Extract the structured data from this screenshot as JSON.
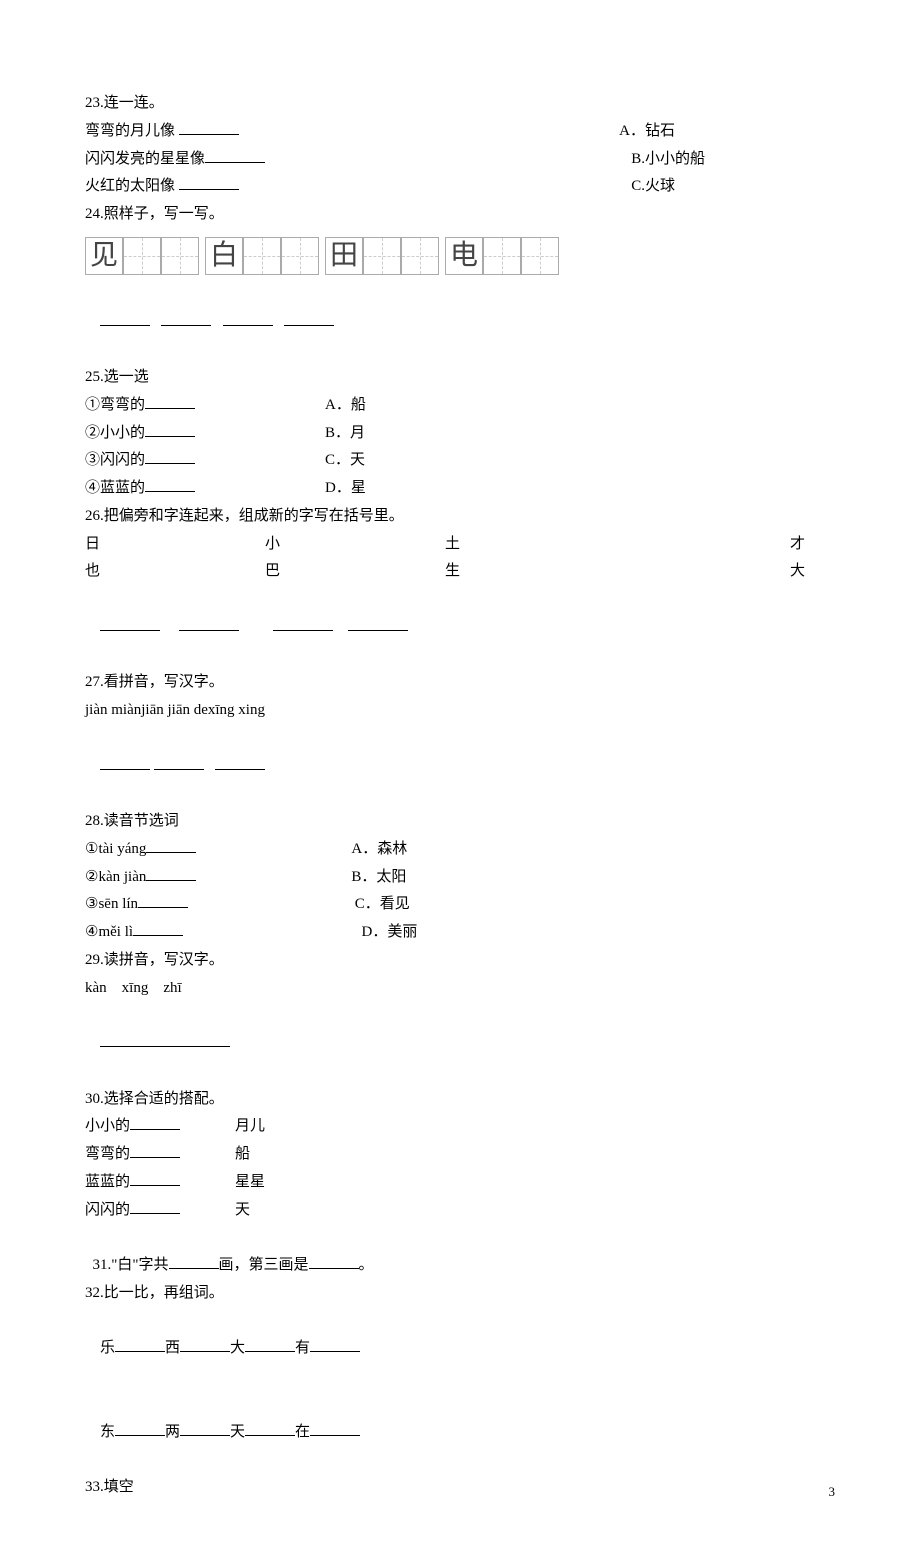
{
  "q23": {
    "title": "23.连一连。",
    "rows": [
      {
        "left": "弯弯的月儿像 ",
        "right": "A．钻石"
      },
      {
        "left": "闪闪发亮的星星像",
        "right": "B.小小的船"
      },
      {
        "left": "火红的太阳像  ",
        "right": "C.火球"
      }
    ]
  },
  "q24": {
    "title": "24.照样子，写一写。",
    "chars": [
      "见",
      "白",
      "田",
      "电"
    ]
  },
  "q25": {
    "title": "25.选一选",
    "items": [
      {
        "num": "①弯弯的",
        "opt": "A．船"
      },
      {
        "num": "②小小的",
        "opt": "B．月"
      },
      {
        "num": "③闪闪的",
        "opt": "C．天"
      },
      {
        "num": "④蓝蓝的",
        "opt": "D．星"
      }
    ]
  },
  "q26": {
    "title": "26.把偏旁和字连起来，组成新的字写在括号里。",
    "row1": [
      "日",
      "小",
      "土",
      "才"
    ],
    "row2": [
      "也",
      "巴",
      "生",
      "大"
    ]
  },
  "q27": {
    "title": "27.看拼音，写汉字。",
    "pinyin": "jiàn miànjiān jiān dexīng xing"
  },
  "q28": {
    "title": "28.读音节选词",
    "items": [
      {
        "num": "①tài yáng",
        "opt": "A．森林",
        "pad": ""
      },
      {
        "num": "②kàn jiàn",
        "opt": "B．太阳",
        "pad": ""
      },
      {
        "num": "③sēn lín",
        "opt": " C．看见",
        "pad": ""
      },
      {
        "num": "④měi lì",
        "opt": "  D．美丽",
        "pad": ""
      }
    ]
  },
  "q29": {
    "title": "29.读拼音，写汉字。",
    "pinyin": "kàn    xīng    zhī"
  },
  "q30": {
    "title": "30.选择合适的搭配。",
    "items": [
      {
        "l": "小小的",
        "r": "月儿"
      },
      {
        "l": "弯弯的",
        "r": "船"
      },
      {
        "l": "蓝蓝的",
        "r": "星星"
      },
      {
        "l": "闪闪的",
        "r": "天"
      }
    ]
  },
  "q31": {
    "p1": "31.\"白\"字共",
    "p2": "画，第三画是",
    "p3": "。"
  },
  "q32": {
    "title": "32.比一比，再组词。",
    "row1": [
      "乐",
      "西",
      "大",
      "有"
    ],
    "row2": [
      "东",
      "两",
      "天",
      "在"
    ]
  },
  "q33": {
    "title": "33.填空"
  },
  "page": "3"
}
